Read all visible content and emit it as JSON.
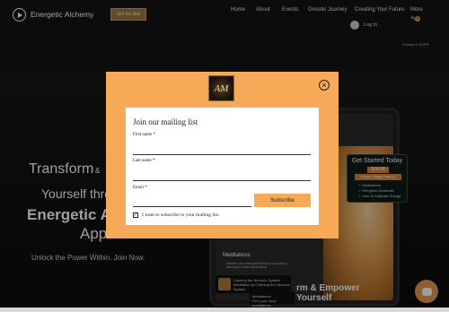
{
  "header": {
    "brand": "Energetic Alchemy",
    "join_button": "Join the App",
    "nav": [
      "Home",
      "About",
      "Events",
      "Gnostic Journey",
      "Creating Your Future",
      "More"
    ],
    "cart_count": "0",
    "login": "Log In",
    "policy": "Privacy & GDPR"
  },
  "hero": {
    "line1": "Transform",
    "amp": "&",
    "line2": "Yourself thro",
    "line3": "Energetic A",
    "line4": "App",
    "tagline": "Unlock the Power Within. Join Now."
  },
  "app_preview": {
    "section_title": "Meditations",
    "section_desc": "Nourish your mind and restore your body by listening to these Meditations",
    "track1": "Calming the Nervous System\nMeditation for Calming the Nervous System",
    "track2": "Meditations\nFind your body meditations",
    "banner": "rm & Empower\nYourself"
  },
  "offer": {
    "title": "Get Started Today",
    "price": "$24.99",
    "trial": "7 DAY FREE TRIAL",
    "items": [
      "Meditations",
      "Energetic Alchemist",
      "Intro to Cultivate Energy"
    ]
  },
  "modal": {
    "logo": "AM",
    "close_icon": "×",
    "title": "Join our mailing list",
    "first_name_label": "First name *",
    "last_name_label": "Last name *",
    "email_label": "Email *",
    "subscribe": "Subscribe",
    "checkbox_mark": "✓",
    "consent": "I want to subscribe to your mailing list."
  },
  "colors": {
    "accent": "#f6a957",
    "header_bg": "#141414",
    "join_btn": "#a0784a",
    "chat": "#e79a4e"
  }
}
